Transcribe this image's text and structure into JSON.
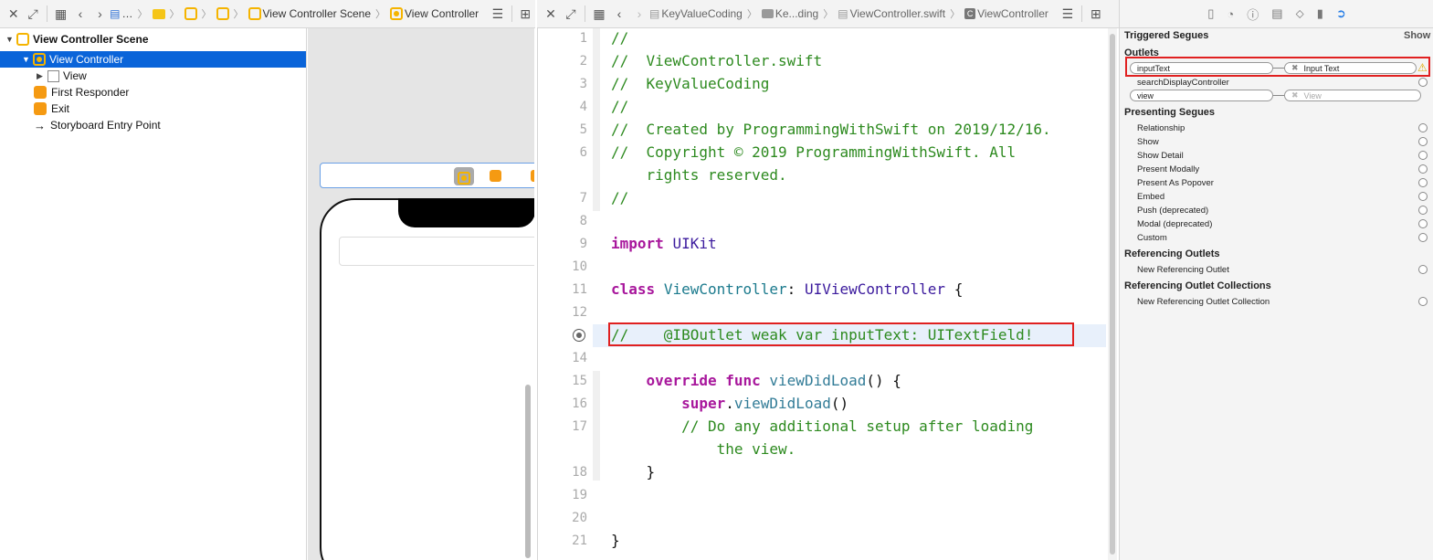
{
  "left_toolbar": {
    "ellipsis": "…",
    "scene_crumb": "View Controller Scene",
    "vc_crumb": "View Controller"
  },
  "outline": {
    "scene": "View Controller Scene",
    "items": [
      {
        "label": "View Controller"
      },
      {
        "label": "View"
      },
      {
        "label": "First Responder"
      },
      {
        "label": "Exit"
      },
      {
        "label": "Storyboard Entry Point"
      }
    ]
  },
  "editor_toolbar": {
    "crumbs": [
      "KeyValueCoding",
      "Ke...ding",
      "ViewController.swift",
      "ViewController"
    ]
  },
  "code": {
    "lines": [
      {
        "n": "1",
        "text": "//"
      },
      {
        "n": "2",
        "text": "//  ViewController.swift"
      },
      {
        "n": "3",
        "text": "//  KeyValueCoding"
      },
      {
        "n": "4",
        "text": "//"
      },
      {
        "n": "5",
        "text": "//  Created by ProgrammingWithSwift on 2019/12/16."
      },
      {
        "n": "6",
        "text": "//  Copyright © 2019 ProgrammingWithSwift. All"
      },
      {
        "n": "",
        "text": "    rights reserved."
      },
      {
        "n": "7",
        "text": "//"
      },
      {
        "n": "8",
        "text": ""
      },
      {
        "n": "9",
        "text": "import UIKit"
      },
      {
        "n": "10",
        "text": ""
      },
      {
        "n": "11",
        "text": "class ViewController: UIViewController {"
      },
      {
        "n": "12",
        "text": ""
      },
      {
        "n": "",
        "text": "//    @IBOutlet weak var inputText: UITextField!"
      },
      {
        "n": "14",
        "text": ""
      },
      {
        "n": "15",
        "text": "    override func viewDidLoad() {"
      },
      {
        "n": "16",
        "text": "        super.viewDidLoad()"
      },
      {
        "n": "17",
        "text": "        // Do any additional setup after loading"
      },
      {
        "n": "",
        "text": "            the view."
      },
      {
        "n": "18",
        "text": "    }"
      },
      {
        "n": "19",
        "text": ""
      },
      {
        "n": "20",
        "text": ""
      },
      {
        "n": "21",
        "text": "}"
      }
    ]
  },
  "inspector": {
    "triggered_segues": "Triggered Segues",
    "show": "Show",
    "outlets_title": "Outlets",
    "outlets": [
      {
        "name": "inputText",
        "target": "Input Text"
      },
      {
        "name": "searchDisplayController",
        "target": ""
      },
      {
        "name": "view",
        "target": "View"
      }
    ],
    "presenting_title": "Presenting Segues",
    "presenting": [
      "Relationship",
      "Show",
      "Show Detail",
      "Present Modally",
      "Present As Popover",
      "Embed",
      "Push (deprecated)",
      "Modal (deprecated)",
      "Custom"
    ],
    "ref_outlets_title": "Referencing Outlets",
    "new_ref_outlet": "New Referencing Outlet",
    "ref_coll_title": "Referencing Outlet Collections",
    "new_ref_coll": "New Referencing Outlet Collection"
  },
  "colors": {
    "selection": "#0a64d9",
    "highlight": "#e02020",
    "comment": "#2d8a1f",
    "keyword": "#a8179c"
  }
}
